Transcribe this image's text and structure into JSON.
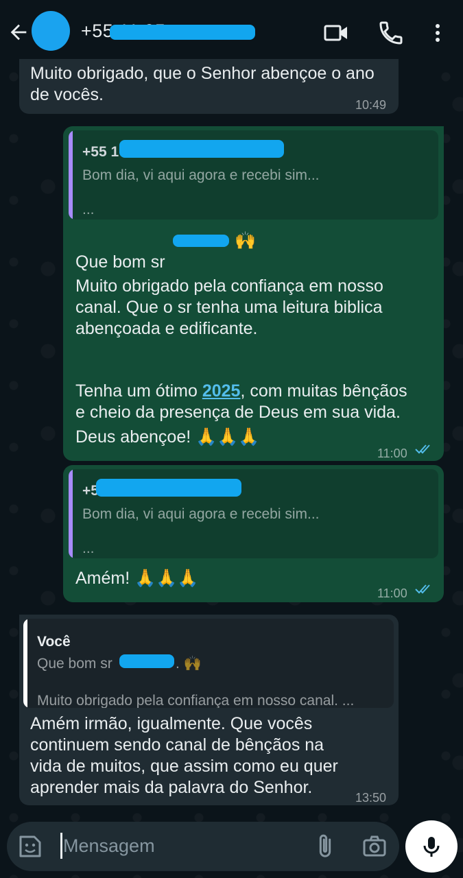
{
  "header": {
    "contact": "+55 11 95"
  },
  "messages": [
    {
      "text": "Muito obrigado, que o Senhor abençoe o ano\nde vocês.",
      "time": "10:49"
    },
    {
      "quote_name": "+55 1",
      "quote_line1": "Bom dia, vi aqui agora e recebi sim...",
      "quote_line2": "...",
      "line1": "Que bom sr",
      "line1_emoji": "🙌",
      "para2": "Muito obrigado pela confiança em nosso\ncanal. Que o sr tenha uma leitura biblica\nabençoada e edificante.",
      "para3_pre": "Tenha um ótimo ",
      "para3_year": "2025",
      "para3_post": ", com muitas bênçãos\ne cheio da presença de Deus em sua vida.",
      "para4": "Deus abençoe! 🙏🙏🙏",
      "time": "11:00"
    },
    {
      "quote_name": "+5",
      "quote_line1": "Bom dia, vi aqui agora e recebi sim...",
      "quote_line2": "...",
      "text": "Amém! 🙏🙏🙏",
      "time": "11:00"
    },
    {
      "quote_name": "Você",
      "quote_line1": "Que bom sr",
      "quote_line1_end": ". 🙌",
      "quote_line2": "Muito obrigado pela confiança em nosso canal. ...",
      "text": "Amém irmão, igualmente. Que vocês\ncontinuem sendo canal de bênçãos na\nvida de muitos, que assim como eu quer\naprender mais da palavra do Senhor.",
      "time": "13:50"
    }
  ],
  "input": {
    "placeholder": "Mensagem"
  },
  "colors": {
    "incoming": "#202c33",
    "outgoing": "#134d37",
    "quote_bar_out": "#a78bfa",
    "quote_bar_in": "#ffffff",
    "read_ticks": "#53bdeb",
    "redaction": "#12a6ef"
  },
  "icons": [
    "back-arrow-icon",
    "video-call-icon",
    "phone-icon",
    "more-vert-icon",
    "sticker-icon",
    "attach-icon",
    "camera-icon",
    "mic-icon",
    "double-check-icon"
  ]
}
